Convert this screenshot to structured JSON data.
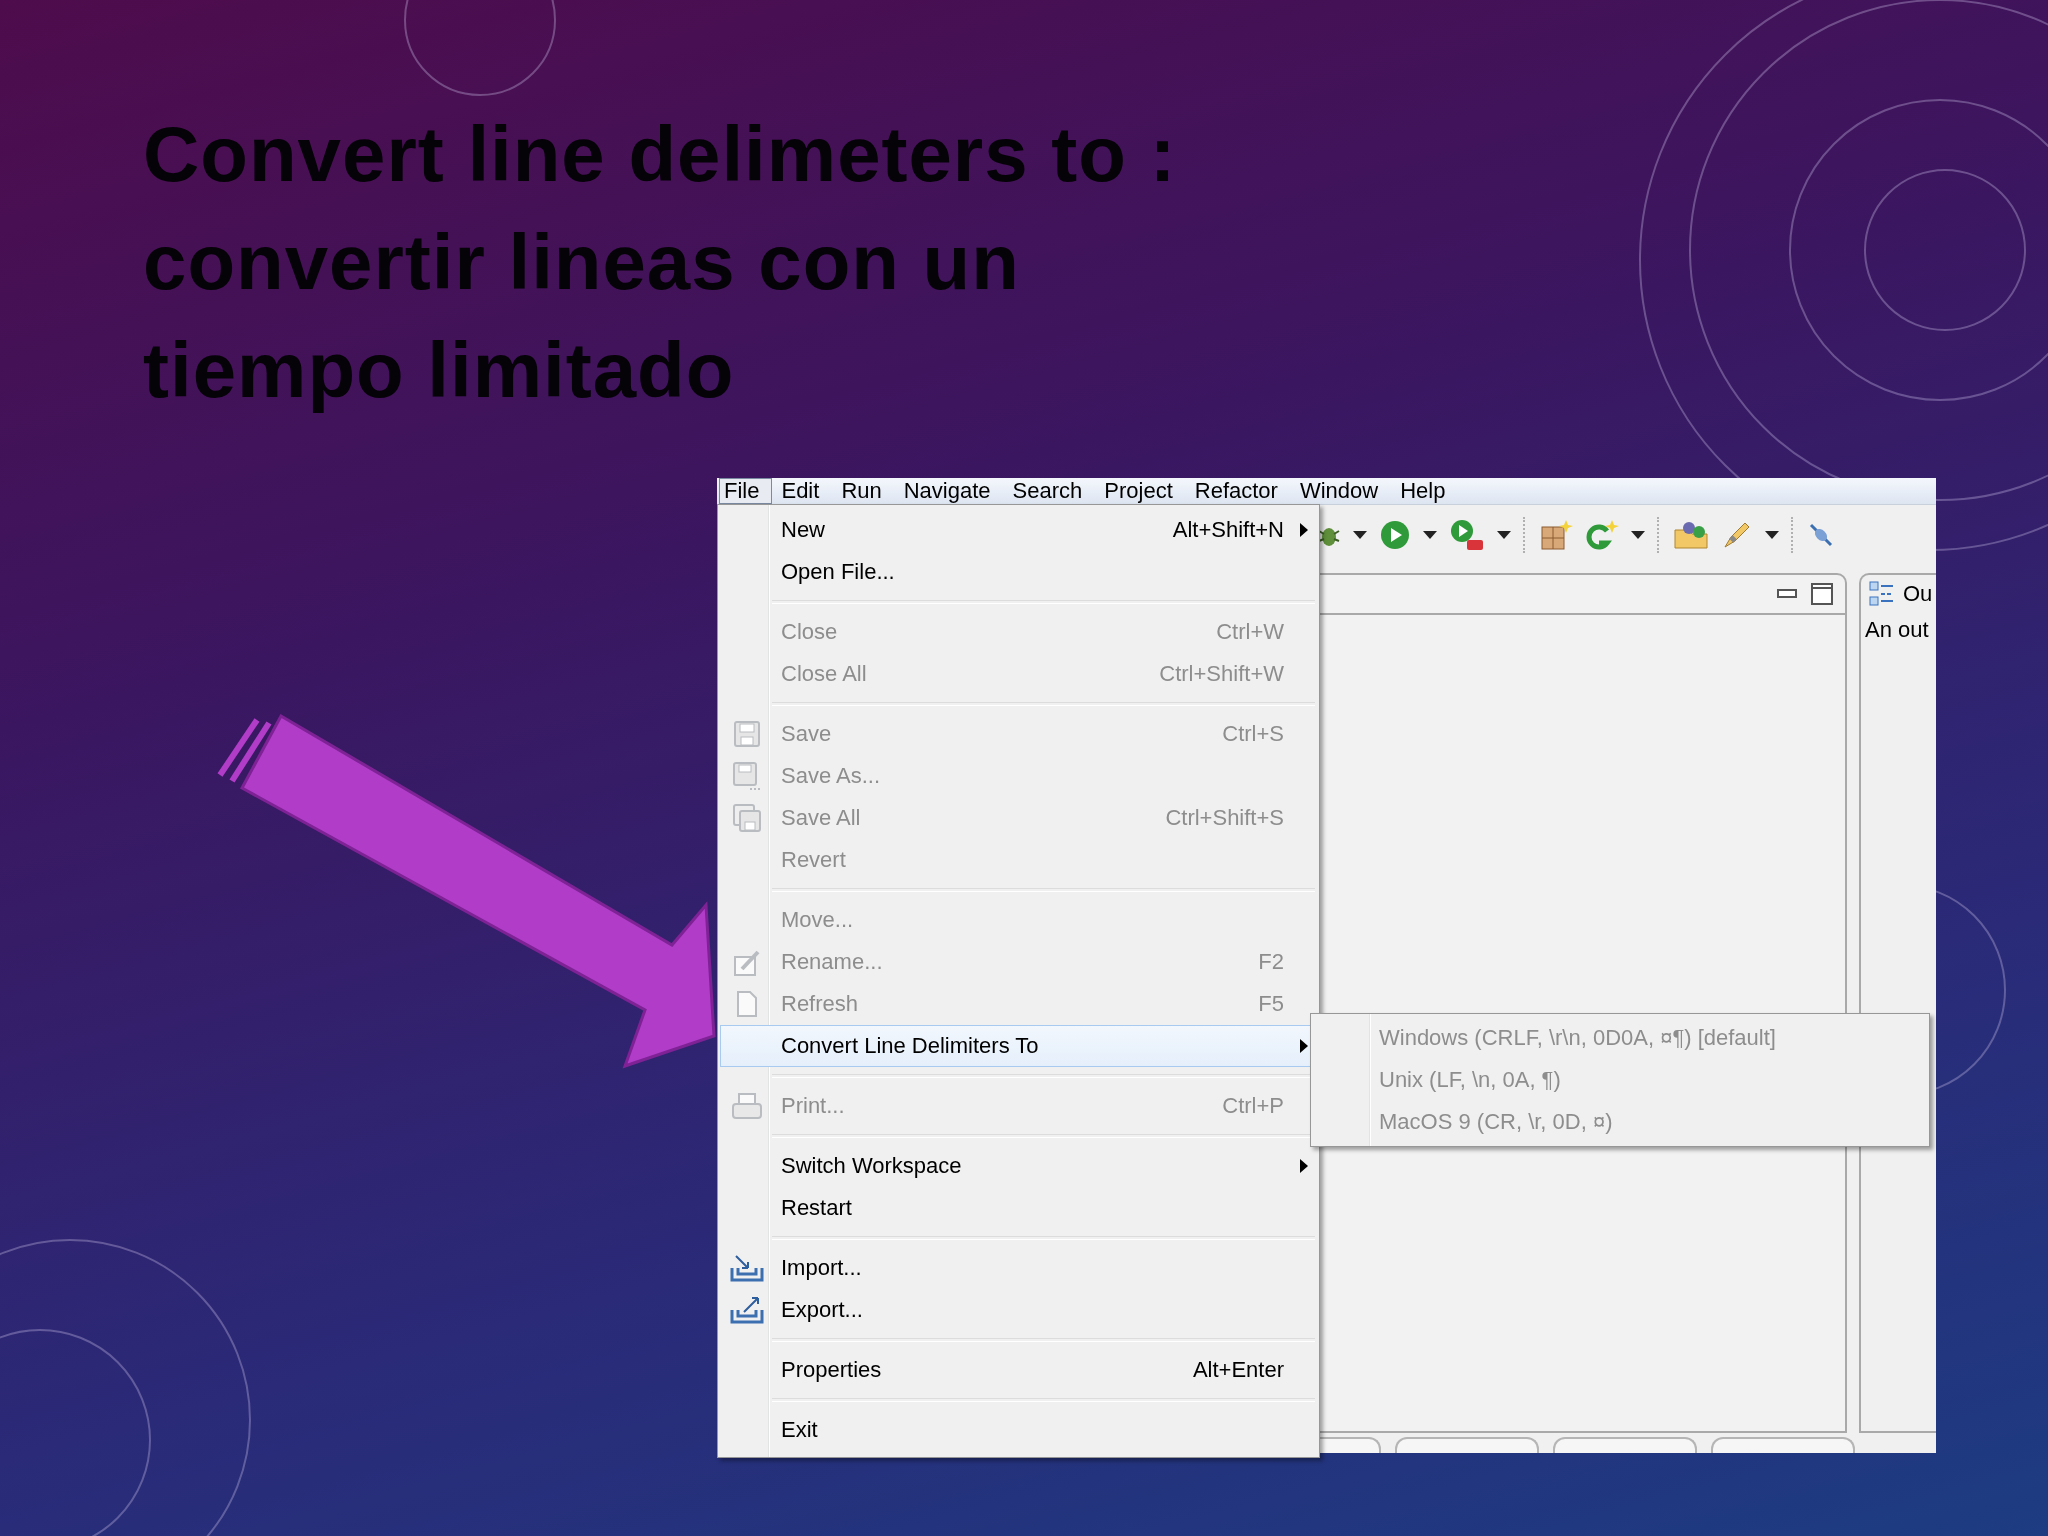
{
  "slide": {
    "title_lines": [
      "Convert line delimeters to :",
      "convertir lineas con un",
      "tiempo limitado"
    ]
  },
  "ide": {
    "menu_bar": [
      {
        "label": "File",
        "selected": true
      },
      {
        "label": "Edit",
        "selected": false
      },
      {
        "label": "Run",
        "selected": false
      },
      {
        "label": "Navigate",
        "selected": false
      },
      {
        "label": "Search",
        "selected": false
      },
      {
        "label": "Project",
        "selected": false
      },
      {
        "label": "Refactor",
        "selected": false
      },
      {
        "label": "Window",
        "selected": false
      },
      {
        "label": "Help",
        "selected": false
      }
    ],
    "file_menu": {
      "groups": [
        [
          {
            "label": "New",
            "shortcut": "Alt+Shift+N",
            "disabled": false,
            "submenu": true,
            "selected": false
          },
          {
            "label": "Open File...",
            "disabled": false,
            "submenu": false,
            "selected": false
          }
        ],
        [
          {
            "label": "Close",
            "shortcut": "Ctrl+W",
            "disabled": true,
            "submenu": false,
            "selected": false
          },
          {
            "label": "Close All",
            "shortcut": "Ctrl+Shift+W",
            "disabled": true,
            "submenu": false,
            "selected": false
          }
        ],
        [
          {
            "label": "Save",
            "shortcut": "Ctrl+S",
            "disabled": true,
            "submenu": false,
            "selected": false
          },
          {
            "label": "Save As...",
            "disabled": true,
            "submenu": false,
            "selected": false
          },
          {
            "label": "Save All",
            "shortcut": "Ctrl+Shift+S",
            "disabled": true,
            "submenu": false,
            "selected": false
          },
          {
            "label": "Revert",
            "disabled": true,
            "submenu": false,
            "selected": false
          }
        ],
        [
          {
            "label": "Move...",
            "disabled": true,
            "submenu": false,
            "selected": false
          },
          {
            "label": "Rename...",
            "shortcut": "F2",
            "disabled": true,
            "submenu": false,
            "selected": false
          },
          {
            "label": "Refresh",
            "shortcut": "F5",
            "disabled": true,
            "submenu": false,
            "selected": false
          },
          {
            "label": "Convert Line Delimiters To",
            "disabled": false,
            "submenu": true,
            "selected": true
          }
        ],
        [
          {
            "label": "Print...",
            "shortcut": "Ctrl+P",
            "disabled": true,
            "submenu": false,
            "selected": false
          }
        ],
        [
          {
            "label": "Switch Workspace",
            "disabled": false,
            "submenu": true,
            "selected": false
          },
          {
            "label": "Restart",
            "disabled": false,
            "submenu": false,
            "selected": false
          }
        ],
        [
          {
            "label": "Import...",
            "disabled": false,
            "submenu": false,
            "selected": false
          },
          {
            "label": "Export...",
            "disabled": false,
            "submenu": false,
            "selected": false
          }
        ],
        [
          {
            "label": "Properties",
            "shortcut": "Alt+Enter",
            "disabled": false,
            "submenu": false,
            "selected": false
          }
        ],
        [
          {
            "label": "Exit",
            "disabled": false,
            "submenu": false,
            "selected": false
          }
        ]
      ]
    },
    "submenu": [
      {
        "label": "Windows (CRLF, \\r\\n, 0D0A, ¤¶) [default]",
        "disabled": true
      },
      {
        "label": "Unix (LF, \\n, 0A, ¶)",
        "disabled": true
      },
      {
        "label": "MacOS 9 (CR, \\r, 0D, ¤)",
        "disabled": true
      }
    ],
    "outline_view": {
      "tab_label": "Ou",
      "message": "An out"
    }
  }
}
